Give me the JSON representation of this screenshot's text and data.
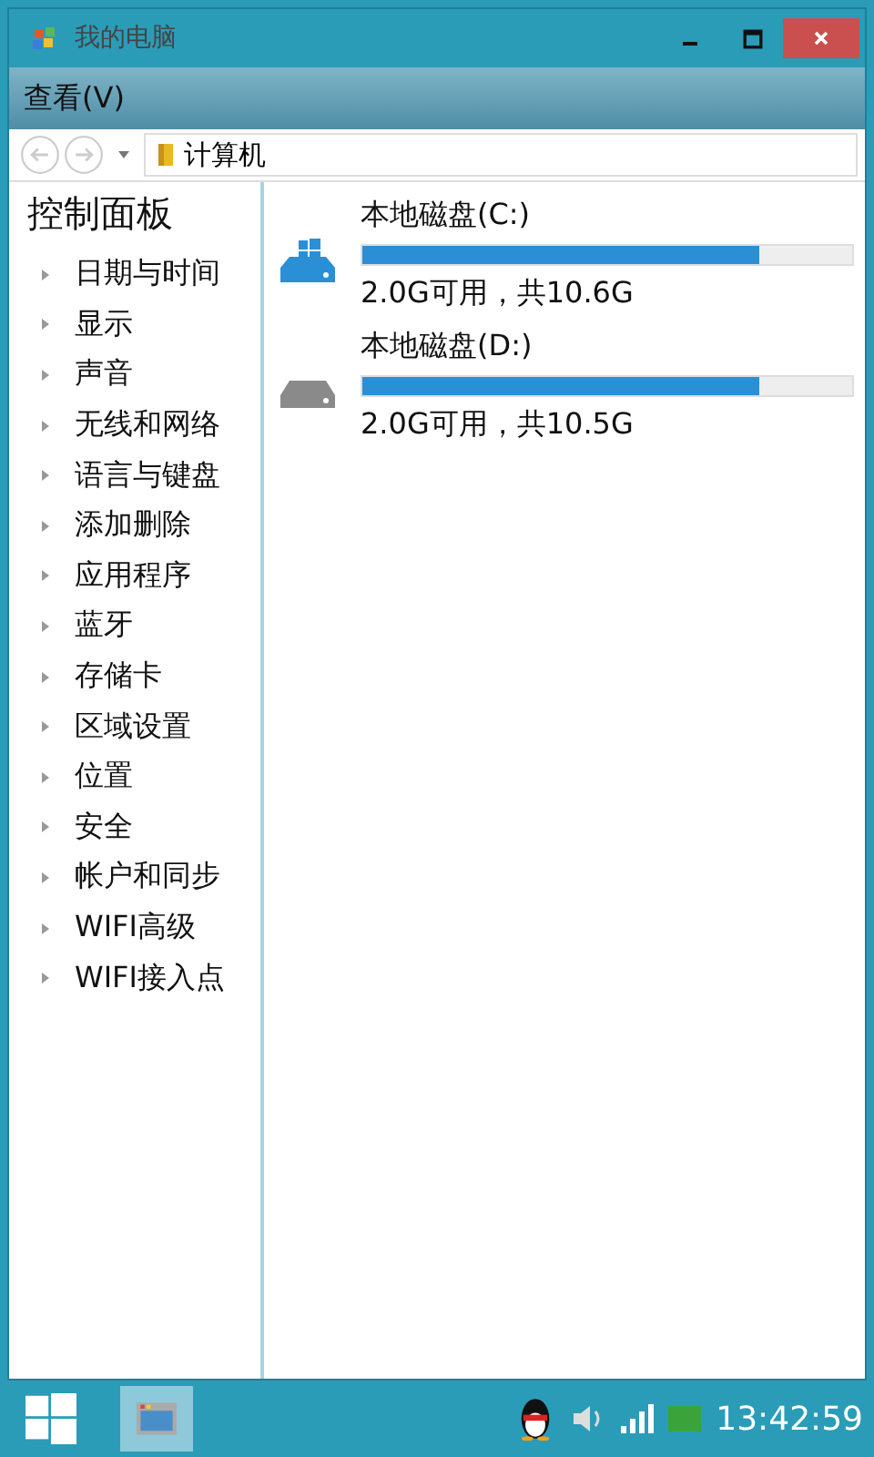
{
  "window": {
    "title": "我的电脑"
  },
  "menu": [
    "查看(V)"
  ],
  "address": {
    "path": "计算机"
  },
  "sidebar": {
    "title": "控制面板",
    "items": [
      "日期与时间",
      "显示",
      "声音",
      "无线和网络",
      "语言与键盘",
      "添加删除",
      "应用程序",
      "蓝牙",
      "存储卡",
      "区域设置",
      "位置",
      "安全",
      "帐户和同步",
      "WIFI高级",
      "WIFI接入点"
    ]
  },
  "drives": [
    {
      "name": "本地磁盘(C:)",
      "kind": "system",
      "level": 0.81,
      "free": "2.0G可用，共10.6G"
    },
    {
      "name": "本地磁盘(D:)",
      "kind": "data",
      "level": 0.81,
      "free": "2.0G可用，共10.5G"
    }
  ],
  "taskbar": {
    "clock": "13:42:59"
  }
}
